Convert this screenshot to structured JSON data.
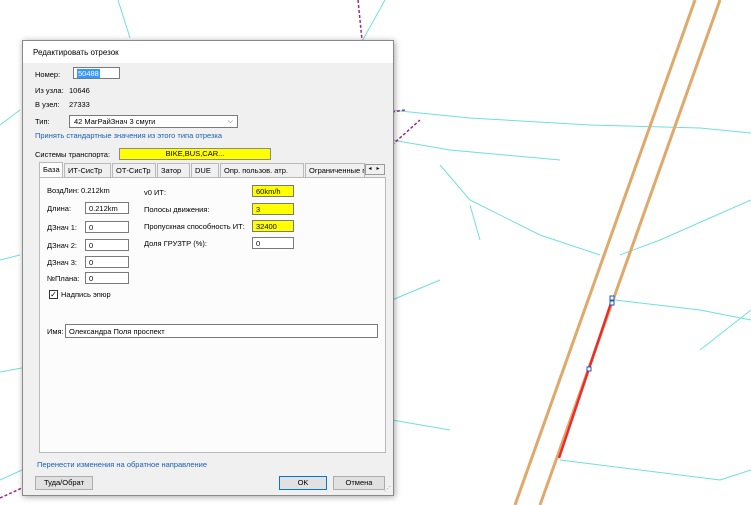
{
  "dialog": {
    "title": "Редактировать отрезок",
    "number_label": "Номер:",
    "number_value": "50488",
    "from_node_label": "Из узла:",
    "from_node_value": "10646",
    "to_node_label": "В узел:",
    "to_node_value": "27333",
    "type_label": "Тип:",
    "type_value": "42 МагРайЗнач 3 смуги",
    "apply_defaults_link": "Принять стандартные значения из этого типа отрезка",
    "transport_label": "Системы транспорта:",
    "transport_value": "BIKE,BUS,CAR...",
    "tabs": [
      "База",
      "ИТ-СисТр",
      "ОТ-СисТр",
      "Затор",
      "DUE",
      "Опр. пользов. атр.",
      "Ограниченные по вр"
    ],
    "base": {
      "airline_label": "ВоздЛин:",
      "airline_value": "0.212km",
      "length_label": "Длина:",
      "length_value": "0.212km",
      "d1_label": "ДЗнач 1:",
      "d1_value": "0",
      "d2_label": "ДЗнач 2:",
      "d2_value": "0",
      "d3_label": "ДЗнач 3:",
      "d3_value": "0",
      "plan_label": "№Плана:",
      "plan_value": "0",
      "checkbox_label": "Надпись эпюр",
      "checkbox_checked": true,
      "v0_label": "v0 ИТ:",
      "v0_value": "60km/h",
      "lanes_label": "Полосы движения:",
      "lanes_value": "3",
      "capacity_label": "Пропускная способность ИТ:",
      "capacity_value": "32400",
      "truck_label": "Доля ГРУЗТР (%):",
      "truck_value": "0",
      "name_label": "Имя:",
      "name_value": "Олександра Поля проспект"
    },
    "reverse_link": "Перенести изменения на обратное направление",
    "swap_button": "Туда/Обрат",
    "ok_button": "OK",
    "cancel_button": "Отмена",
    "scroll_left": "◂",
    "scroll_right": "▸",
    "checkmark": "✓",
    "combo_arrow": "⌵"
  },
  "colors": {
    "road_main": "#e0a86a",
    "road_cyan": "#6fe0dc",
    "selected_link": "#ee2b2b",
    "highlight_yellow": "#ffff00",
    "link_blue": "#1a5fb4"
  }
}
